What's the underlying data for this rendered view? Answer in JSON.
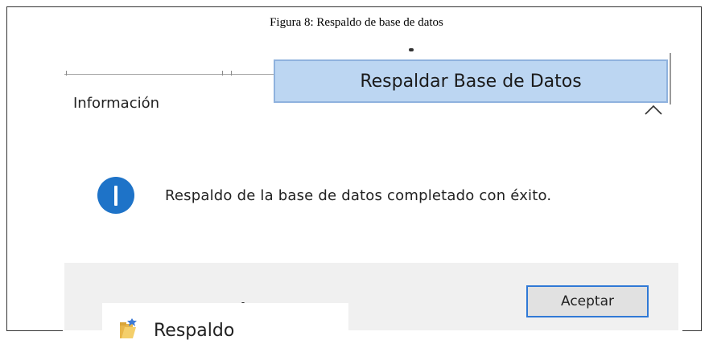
{
  "figure": {
    "caption": "Figura 8: Respaldo de base de datos"
  },
  "toolbar": {
    "backup_button_label": "Respaldar Base de Datos"
  },
  "dialog": {
    "title": "Información",
    "icon": "info-icon",
    "message": "Respaldo de la base de datos completado con éxito.",
    "ok_button_label": "Aceptar"
  },
  "explorer": {
    "folder_label": "Respaldo",
    "folder_icon": "folder-icon"
  },
  "colors": {
    "accent": "#1e73c8",
    "button_highlight": "#bcd6f2",
    "footer_bg": "#f0f0f0"
  }
}
